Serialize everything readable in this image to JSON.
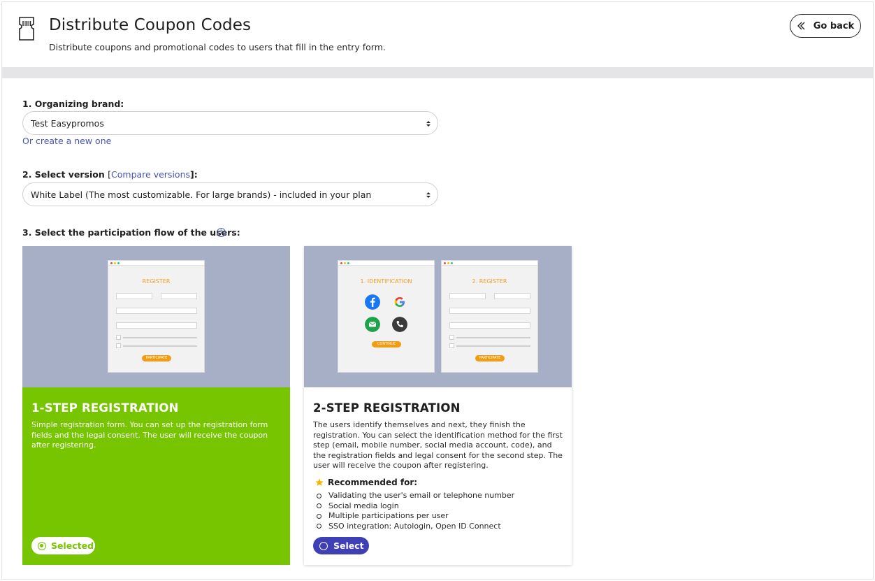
{
  "header": {
    "title": "Distribute Coupon Codes",
    "subtitle": "Distribute coupons and promotional codes to users that fill in the entry form.",
    "go_back_label": "Go back",
    "icon": "coupon-ticket-icon"
  },
  "form": {
    "brand": {
      "label": "1. Organizing brand:",
      "selected_value": "Test Easypromos",
      "create_link": "Or create a new one"
    },
    "version": {
      "label": "2. Select version",
      "compare_prefix": "[",
      "compare_link": "Compare versions",
      "compare_suffix": "]:",
      "selected_value": "White Label (The most customizable. For large brands) - included in your plan"
    },
    "flow": {
      "label": "3. Select the participation flow of the users:",
      "help_icon": "question-circle-icon"
    }
  },
  "cards": [
    {
      "title": "1-STEP REGISTRATION",
      "description": "Simple registration form. You can set up the registration form fields and the legal consent. The user will receive the coupon after registering.",
      "button_label": "Selected",
      "selected": true,
      "accent_color": "#77c400",
      "mock": {
        "register_title": "REGISTER",
        "participate_label": "PARTICIPATE"
      }
    },
    {
      "title": "2-STEP REGISTRATION",
      "description": "The users identify themselves and next, they finish the registration. You can select the identification method for the first step (email, mobile number, social media account, code), and the registration fields and legal consent for the second step. The user will receive the coupon after registering.",
      "recommended_label": "Recommended for:",
      "recommended_items": [
        "Validating the user's email or telephone number",
        "Social media login",
        "Multiple participations per user",
        "SSO integration: Autologin, Open ID Connect"
      ],
      "button_label": "Select",
      "selected": false,
      "accent_color": "#3f3fb6",
      "mock": {
        "identification_title": "1. IDENTIFICATION",
        "continue_label": "CONTINUE",
        "register_title": "2. REGISTER",
        "participate_label": "PARTICIPATE"
      }
    }
  ]
}
